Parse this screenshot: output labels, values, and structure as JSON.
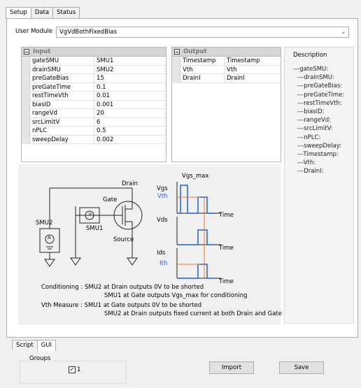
{
  "tabs_top": [
    "Setup",
    "Data",
    "Status"
  ],
  "user_module": {
    "label": "User Module",
    "value": "VgVdBothFixedBias"
  },
  "input": {
    "header": "Input",
    "rows": [
      [
        "gateSMU",
        "SMU1"
      ],
      [
        "drainSMU",
        "SMU2"
      ],
      [
        "preGateBias",
        "15"
      ],
      [
        "preGateTime",
        "0.1"
      ],
      [
        "restTimeVth",
        "0.01"
      ],
      [
        "biasID",
        "0.001"
      ],
      [
        "rangeVd",
        "20"
      ],
      [
        "srcLimitV",
        "6"
      ],
      [
        "nPLC",
        "0.5"
      ],
      [
        "sweepDelay",
        "0.002"
      ]
    ]
  },
  "output": {
    "header": "Output",
    "rows": [
      [
        "Timestamp",
        "Timestamp"
      ],
      [
        "Vth",
        "Vth"
      ],
      [
        "DrainI",
        "DrainI"
      ]
    ]
  },
  "description": {
    "title": "Description",
    "lines": [
      "---gateSMU:",
      "---drainSMU:",
      "---preGateBias:",
      "---preGateTime:",
      "---restTimeVth:",
      "---biasID:",
      "---rangeVd:",
      "---srcLimitV:",
      "---nPLC:",
      "---sweepDelay:",
      "---Timestamp:",
      "---Vth:",
      "---DrainI:"
    ]
  },
  "diagram": {
    "drain": "Drain",
    "gate": "Gate",
    "source": "Source",
    "smu2": "SMU2",
    "smu1": "SMU1",
    "a_symbol": "A",
    "v_symbol": ">",
    "vgs_max": "Vgs_max",
    "vgs": "Vgs",
    "vth": "Vth",
    "vds": "Vds",
    "ids": "Ids",
    "ith": "Ith",
    "time": "Time",
    "colors": {
      "blue": "#1f5fd8",
      "orange": "#f07b1f",
      "dark": "#222222"
    }
  },
  "notes": [
    "Conditioning : SMU2 at Drain outputs 0V to be shorted",
    "SMU1 at Gate outputs Vgs_max for conditioning",
    "Vth Measure : SMU1 at Gate outputs 0V to be shorted",
    "SMU2 at Drain outputs fixed current at both Drain and Gate"
  ],
  "tabs_bottom": [
    "Script",
    "GUI"
  ],
  "groups": {
    "label": "Groups",
    "item": "1",
    "checked": true
  },
  "buttons": {
    "import": "Import",
    "save": "Save"
  }
}
